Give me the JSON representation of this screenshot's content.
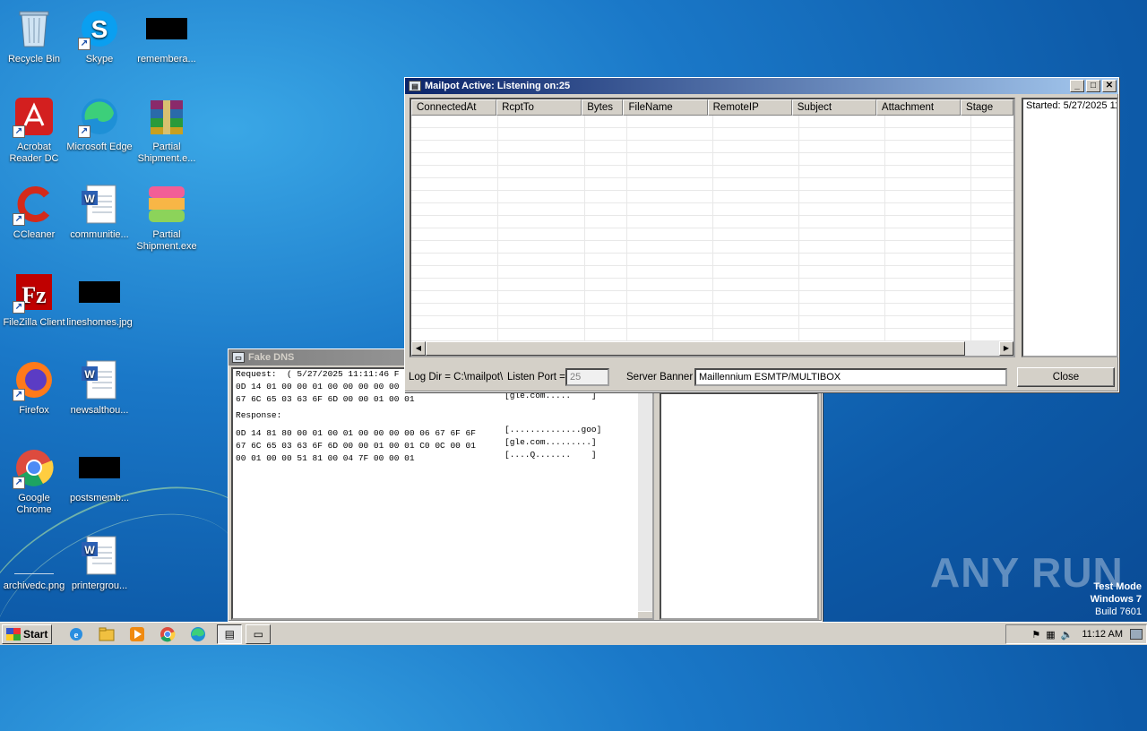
{
  "desktop": {
    "icons": [
      {
        "label": "Recycle Bin",
        "icon": "recycle-bin-icon"
      },
      {
        "label": "Skype",
        "icon": "skype-icon"
      },
      {
        "label": "remembera...",
        "icon": "black-file-icon"
      },
      {
        "label": "Acrobat Reader DC",
        "icon": "acrobat-icon"
      },
      {
        "label": "Microsoft Edge",
        "icon": "edge-icon"
      },
      {
        "label": "Partial Shipment.e...",
        "icon": "winrar-icon"
      },
      {
        "label": "CCleaner",
        "icon": "ccleaner-icon"
      },
      {
        "label": "communitie...",
        "icon": "word-doc-icon"
      },
      {
        "label": "Partial Shipment.exe",
        "icon": "app-exe-icon"
      },
      {
        "label": "FileZilla Client",
        "icon": "filezilla-icon"
      },
      {
        "label": "lineshomes.jpg",
        "icon": "black-image-icon"
      },
      {
        "label": "Firefox",
        "icon": "firefox-icon"
      },
      {
        "label": "newsalthou...",
        "icon": "word-doc-icon"
      },
      {
        "label": "Google Chrome",
        "icon": "chrome-icon"
      },
      {
        "label": "postsmemb...",
        "icon": "black-image-icon"
      },
      {
        "label": "archivedc.png",
        "icon": "blank-image-icon"
      },
      {
        "label": "printergrou...",
        "icon": "word-doc-icon"
      }
    ]
  },
  "mailpot": {
    "title": "Mailpot Active: Listening on:25",
    "columns": [
      "ConnectedAt",
      "RcptTo",
      "Bytes",
      "FileName",
      "RemoteIP",
      "Subject",
      "Attachment",
      "Stage"
    ],
    "log_text": "Started: 5/27/2025 11",
    "log_dir_label": "Log Dir = C:\\mailpot\\",
    "listen_port_label": "Listen Port =",
    "listen_port_value": "25",
    "server_banner_label": "Server Banner",
    "server_banner_value": "Maillennium ESMTP/MULTIBOX",
    "close_label": "Close"
  },
  "fakedns": {
    "title": "Fake DNS",
    "request_line": "Request:  ( 5/27/2025 11:11:46 F",
    "req_hex_1": "0D 14 01 00 00 01 00 00 00 00 00",
    "req_hex_2": "67 6C 65 03 63 6F 6D 00 00 01 00 01",
    "req_ascii_2": "[gle.com.....    ]",
    "response_label": "Response:",
    "resp_hex_1": "0D 14 81 80 00 01 00 01 00 00 00 00 06 67 6F 6F",
    "resp_ascii_1": "[..............goo]",
    "resp_hex_2": "67 6C 65 03 63 6F 6D 00 00 01 00 01 C0 0C 00 01",
    "resp_ascii_2": "[gle.com.........]",
    "resp_hex_3": "00 01 00 00 51 81 00 04 7F 00 00 01",
    "resp_ascii_3": "[....Q.......    ]"
  },
  "taskbar": {
    "start_label": "Start",
    "clock": "11:12 AM"
  },
  "watermark": "ANY RUN",
  "testmode": {
    "line1": "Test Mode",
    "line2": "Windows 7",
    "line3": "Build 7601"
  }
}
